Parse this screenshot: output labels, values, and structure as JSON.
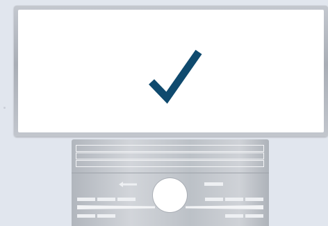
{
  "window": {
    "title": ""
  },
  "screen": {
    "status_icon": "checkmark-icon",
    "status_color": "#0f4a6e",
    "background": "#ffffff"
  },
  "panel": {
    "grille_slots": 3,
    "knob_icon": "control-knob",
    "back_icon": "left-arrow-icon",
    "accent_color": "#f0f2f5"
  },
  "colors": {
    "page_bg": "#e1e6ee",
    "bezel": "#b0b4bb",
    "check": "#0f4a6e"
  }
}
